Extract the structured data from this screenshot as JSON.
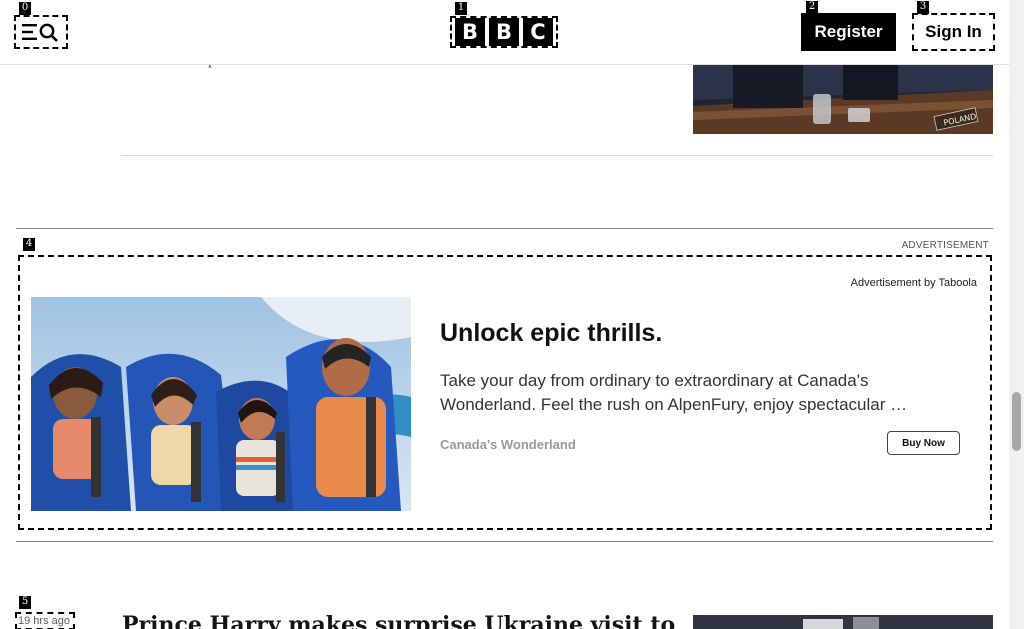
{
  "markers": [
    "0",
    "1",
    "2",
    "3",
    "4",
    "5"
  ],
  "header": {
    "logo_letters": [
      "B",
      "B",
      "C"
    ],
    "register_label": "Register",
    "signin_label": "Sign In"
  },
  "previous_story": {
    "snippet": "…p"
  },
  "advertisement": {
    "label": "ADVERTISEMENT",
    "provider": "Advertisement by Taboola",
    "title": "Unlock epic thrills.",
    "description": "Take your day from ordinary to extraordinary at Canada's Wonderland. Feel the rush on AlpenFury, enjoy spectacular …",
    "brand": "Canada's Wonderland",
    "cta": "Buy Now"
  },
  "next_story": {
    "timestamp": "19 hrs ago",
    "headline": "Prince Harry makes surprise Ukraine visit to"
  },
  "colors": {
    "brand_black": "#000000",
    "text": "#141414",
    "muted": "#999999"
  }
}
